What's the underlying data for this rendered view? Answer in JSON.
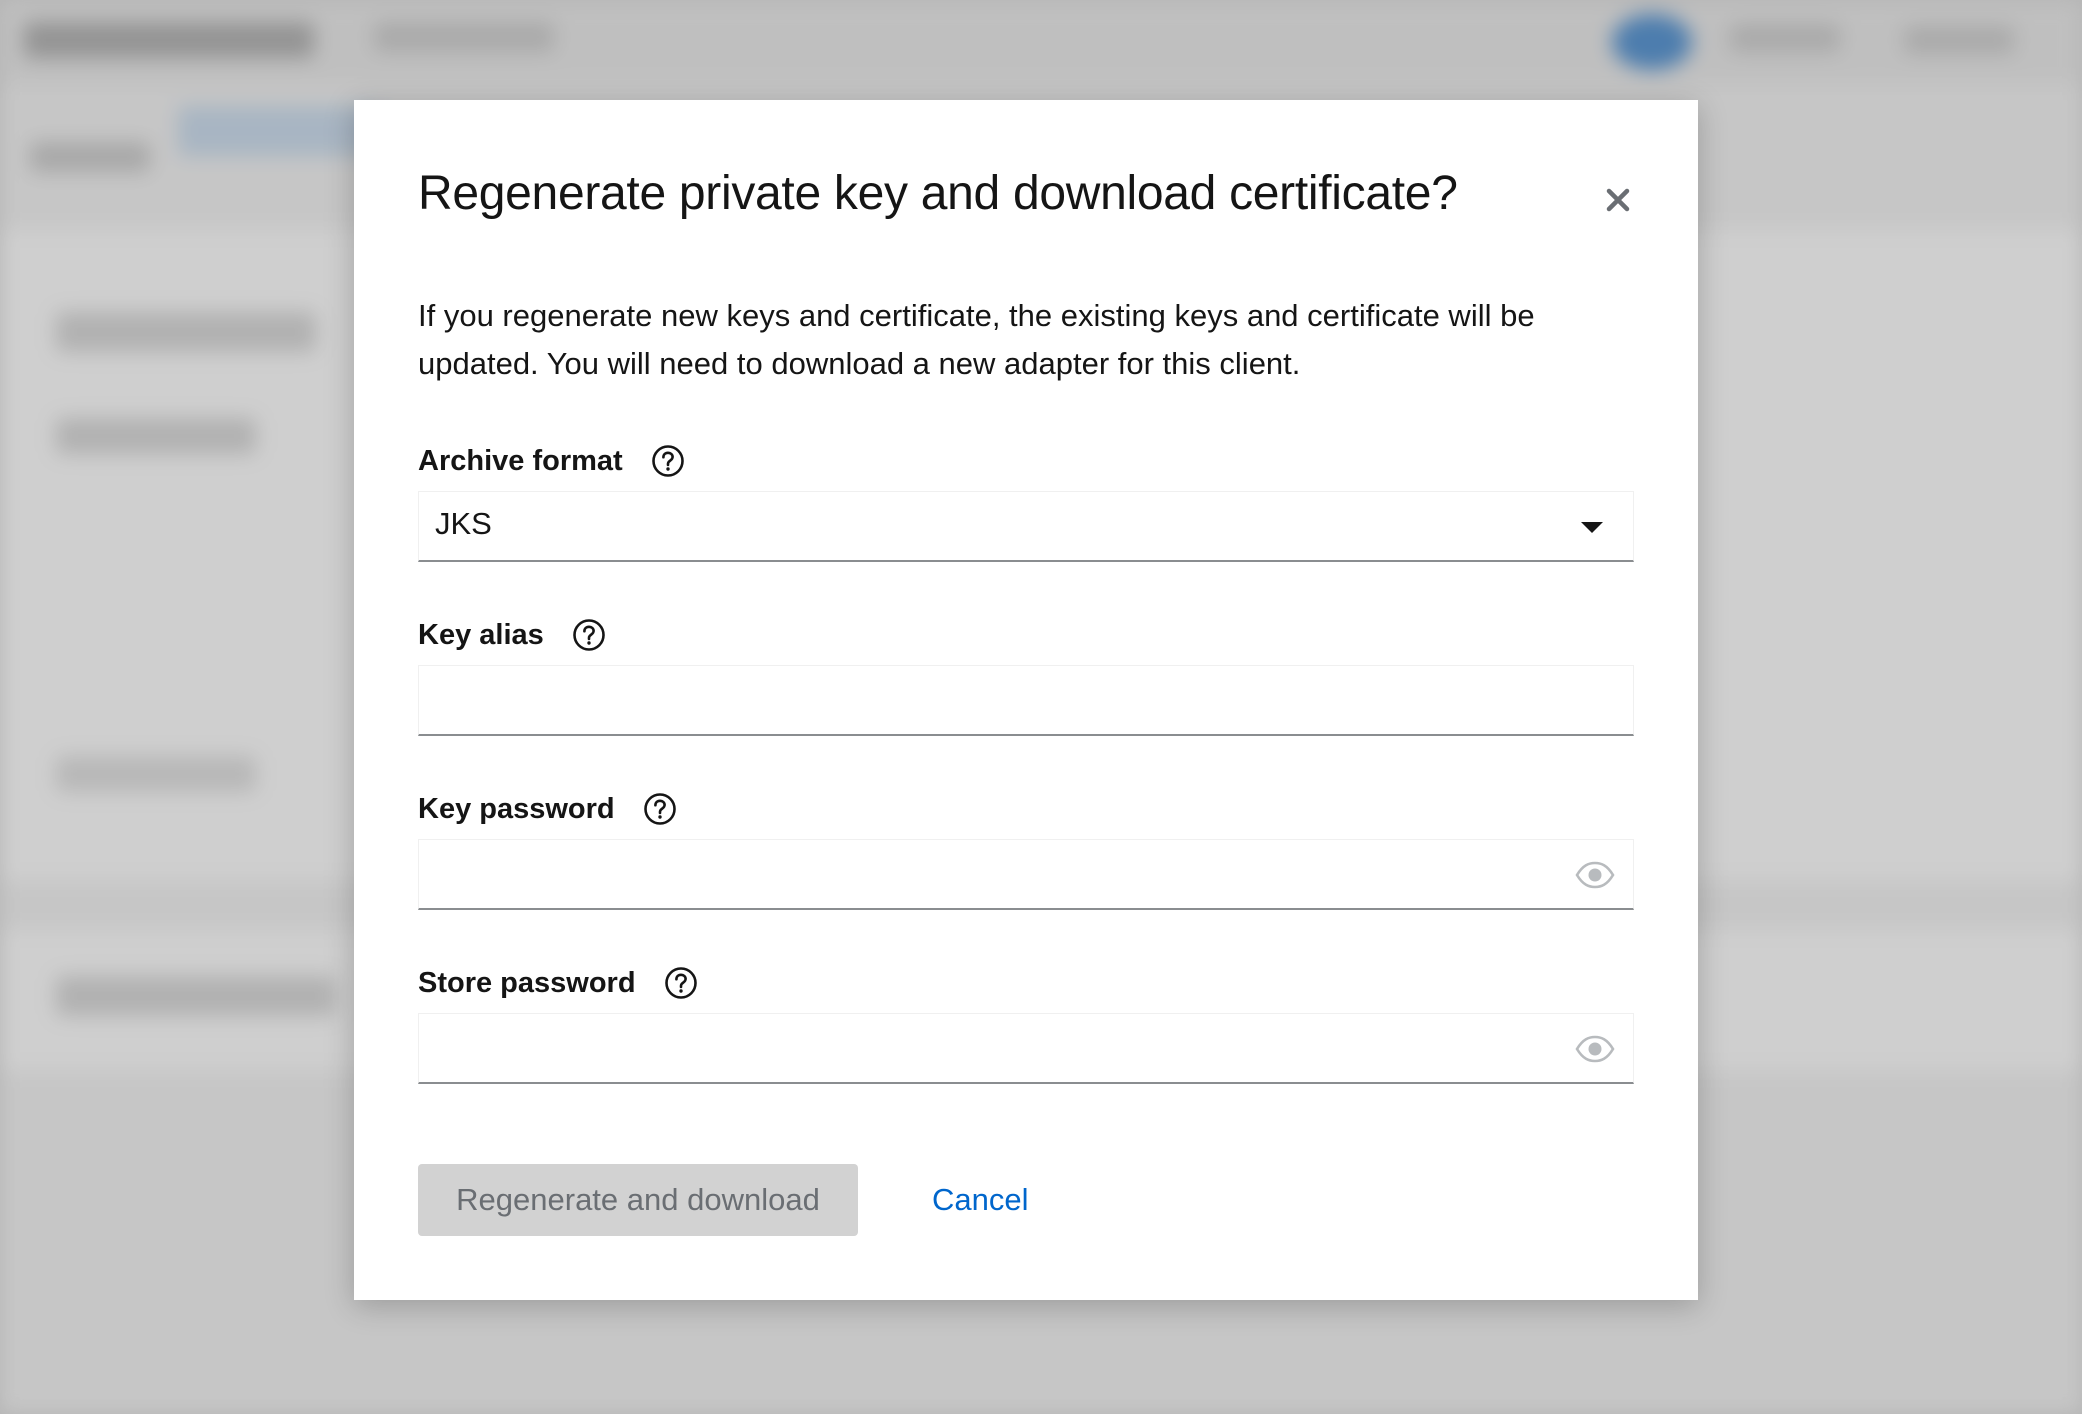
{
  "modal": {
    "title": "Regenerate private key and download certificate?",
    "description": "If you regenerate new keys and certificate, the existing keys and certificate will be updated. You will need to download a new adapter for this client.",
    "fields": {
      "archive_format": {
        "label": "Archive format",
        "value": "JKS"
      },
      "key_alias": {
        "label": "Key alias",
        "value": ""
      },
      "key_password": {
        "label": "Key password",
        "value": ""
      },
      "store_password": {
        "label": "Store password",
        "value": ""
      }
    },
    "actions": {
      "primary_label": "Regenerate and download",
      "cancel_label": "Cancel"
    }
  },
  "icons": [
    "close-icon",
    "help-icon",
    "caret-down-icon",
    "eye-icon"
  ],
  "colors": {
    "link": "#0066cc",
    "disabled_button": "#d2d2d2"
  }
}
